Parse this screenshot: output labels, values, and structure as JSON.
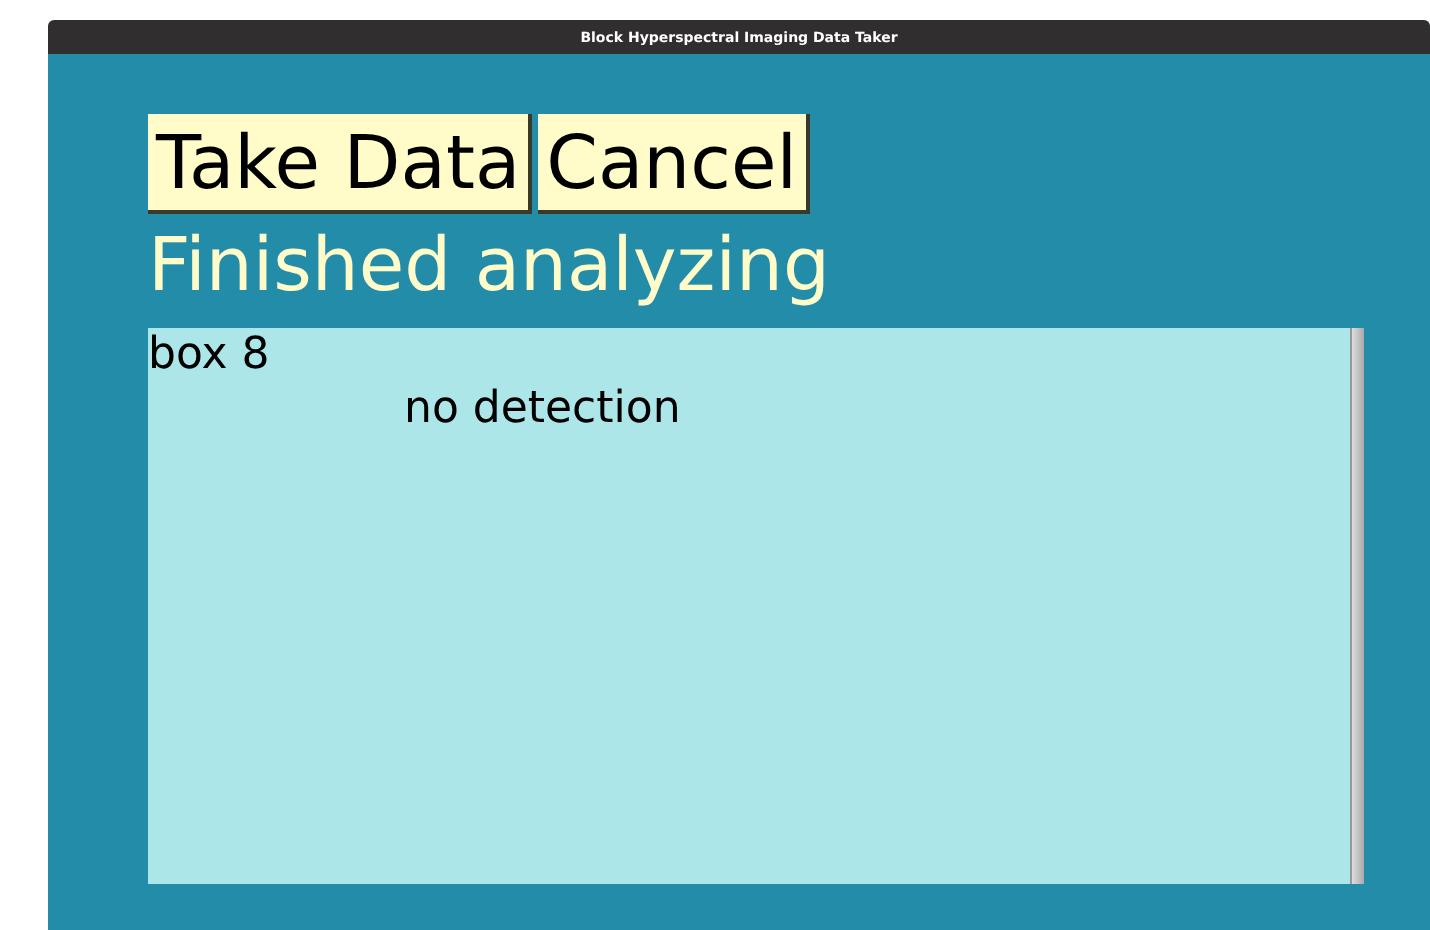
{
  "window": {
    "title": "Block Hyperspectral Imaging Data Taker"
  },
  "buttons": [
    "Take Data",
    "Cancel"
  ],
  "status": "Finished analyzing",
  "log": [
    {
      "text": "box 8",
      "kind": "plain"
    },
    {
      "text": "no detection",
      "kind": "indented"
    }
  ]
}
